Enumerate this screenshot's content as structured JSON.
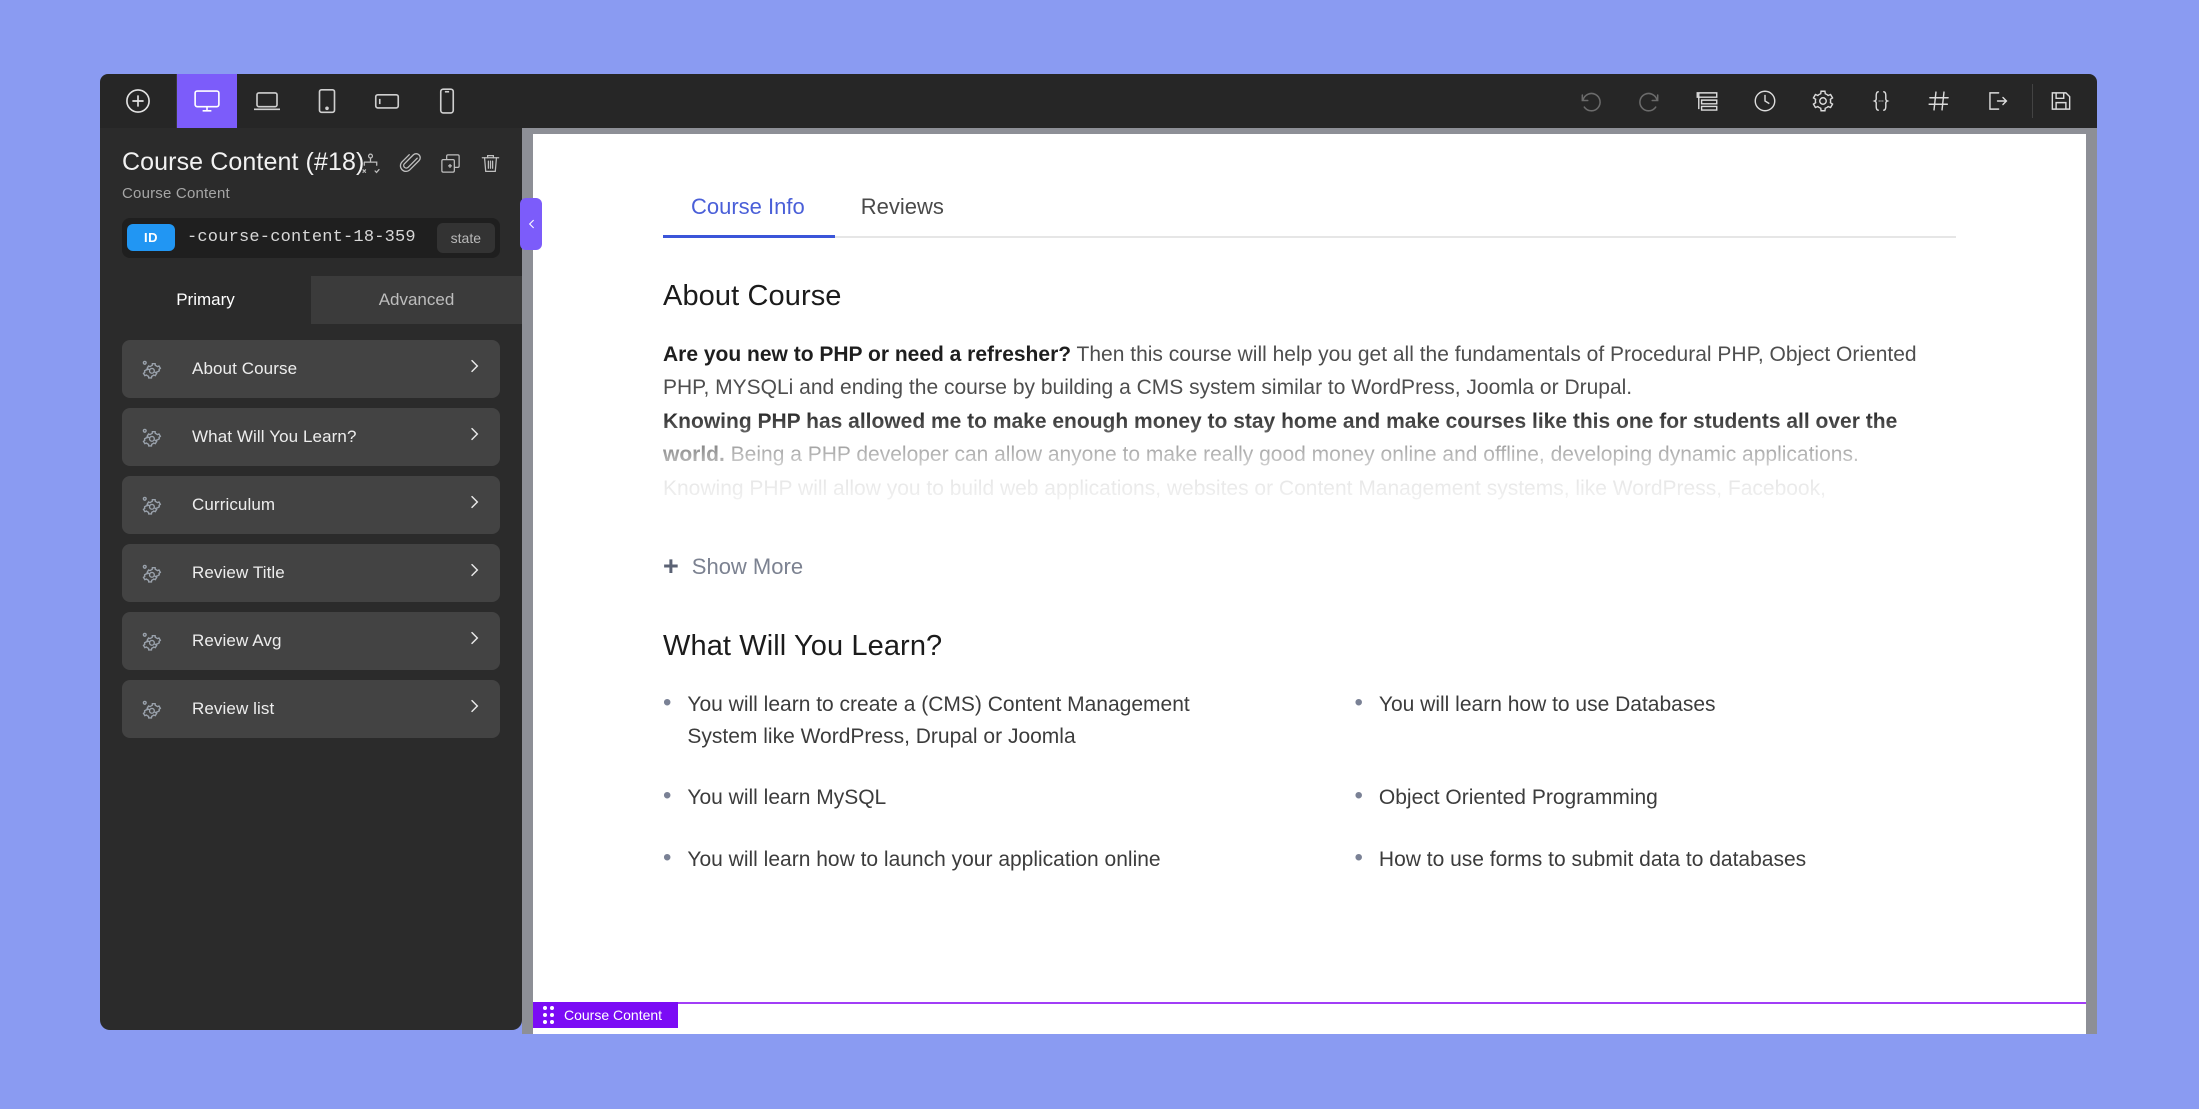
{
  "theme": {
    "page_background": "#8a9bf2",
    "toolbar_background": "#262626",
    "panel_background": "#2b2b2b",
    "accent_purple": "#7c5cfa",
    "selection_purple": "#7b0cf5",
    "id_badge_blue": "#2196f3",
    "site_tab_blue": "#3b55d9"
  },
  "toolbar": {
    "add_label": "add-element",
    "devices": [
      {
        "name": "desktop",
        "icon": "monitor-icon",
        "active": true
      },
      {
        "name": "laptop",
        "icon": "laptop-icon",
        "active": false
      },
      {
        "name": "tablet",
        "icon": "tablet-icon",
        "active": false
      },
      {
        "name": "tablet-landscape",
        "icon": "tablet-landscape-icon",
        "active": false
      },
      {
        "name": "mobile",
        "icon": "mobile-icon",
        "active": false
      }
    ],
    "right_actions": [
      {
        "name": "undo",
        "icon": "undo-icon",
        "dim": true
      },
      {
        "name": "redo",
        "icon": "redo-icon",
        "dim": true
      },
      {
        "name": "layers",
        "icon": "layers-icon",
        "dim": false
      },
      {
        "name": "history",
        "icon": "clock-icon",
        "dim": false
      },
      {
        "name": "settings",
        "icon": "gear-icon",
        "dim": false
      },
      {
        "name": "code",
        "icon": "braces-icon",
        "dim": false
      },
      {
        "name": "grid",
        "icon": "hash-icon",
        "dim": false
      },
      {
        "name": "exit",
        "icon": "exit-icon",
        "dim": false
      }
    ],
    "save": {
      "name": "save",
      "icon": "floppy-icon"
    }
  },
  "panel": {
    "title": "Course Content (#18)",
    "subtitle": "Course Content",
    "actions": [
      {
        "name": "conditions",
        "icon": "conditions-icon"
      },
      {
        "name": "link",
        "icon": "paperclip-icon"
      },
      {
        "name": "duplicate",
        "icon": "duplicate-icon"
      },
      {
        "name": "delete",
        "icon": "trash-icon"
      }
    ],
    "id_badge": "ID",
    "id_value": "-course-content-18-359",
    "state_label": "state",
    "tabs": [
      {
        "label": "Primary",
        "active": true
      },
      {
        "label": "Advanced",
        "active": false
      }
    ],
    "items": [
      {
        "label": "About Course",
        "icon": "gear-settings-icon"
      },
      {
        "label": "What Will You Learn?",
        "icon": "gear-settings-icon"
      },
      {
        "label": "Curriculum",
        "icon": "gear-settings-icon"
      },
      {
        "label": "Review Title",
        "icon": "gear-settings-icon"
      },
      {
        "label": "Review Avg",
        "icon": "gear-settings-icon"
      },
      {
        "label": "Review list",
        "icon": "gear-settings-icon"
      }
    ],
    "collapse_icon": "chevron-left-icon"
  },
  "canvas": {
    "site_tabs": [
      {
        "label": "Course Info",
        "active": true
      },
      {
        "label": "Reviews",
        "active": false
      }
    ],
    "about": {
      "heading": "About Course",
      "para1_bold": "Are you new to PHP or need a refresher?",
      "para1_rest": " Then this course will help you get all the fundamentals of Procedural PHP, Object Oriented PHP, MYSQLi and ending the course by building a CMS system similar to WordPress, Joomla or Drupal.",
      "para2_bold": "Knowing PHP has allowed me to make enough money to stay home and make courses like this one for students all over the world.",
      "para2_rest": " Being a PHP developer can allow anyone to make really good money online and offline, developing dynamic applications.",
      "para3": "Knowing PHP will allow you to build web applications, websites or Content Management systems, like WordPress, Facebook,",
      "show_more_plus": "+",
      "show_more_label": "Show More"
    },
    "learn": {
      "heading": "What Will You Learn?",
      "items": [
        "You will learn to create a (CMS) Content Management System like WordPress, Drupal or Joomla",
        "You will learn how to use Databases",
        "You will learn MySQL",
        "Object Oriented Programming",
        "You will learn how to launch your application online",
        "How to use forms to submit data to databases"
      ]
    },
    "element_label": "Course Content",
    "drag_handle_icon": "drag-dots-icon"
  }
}
